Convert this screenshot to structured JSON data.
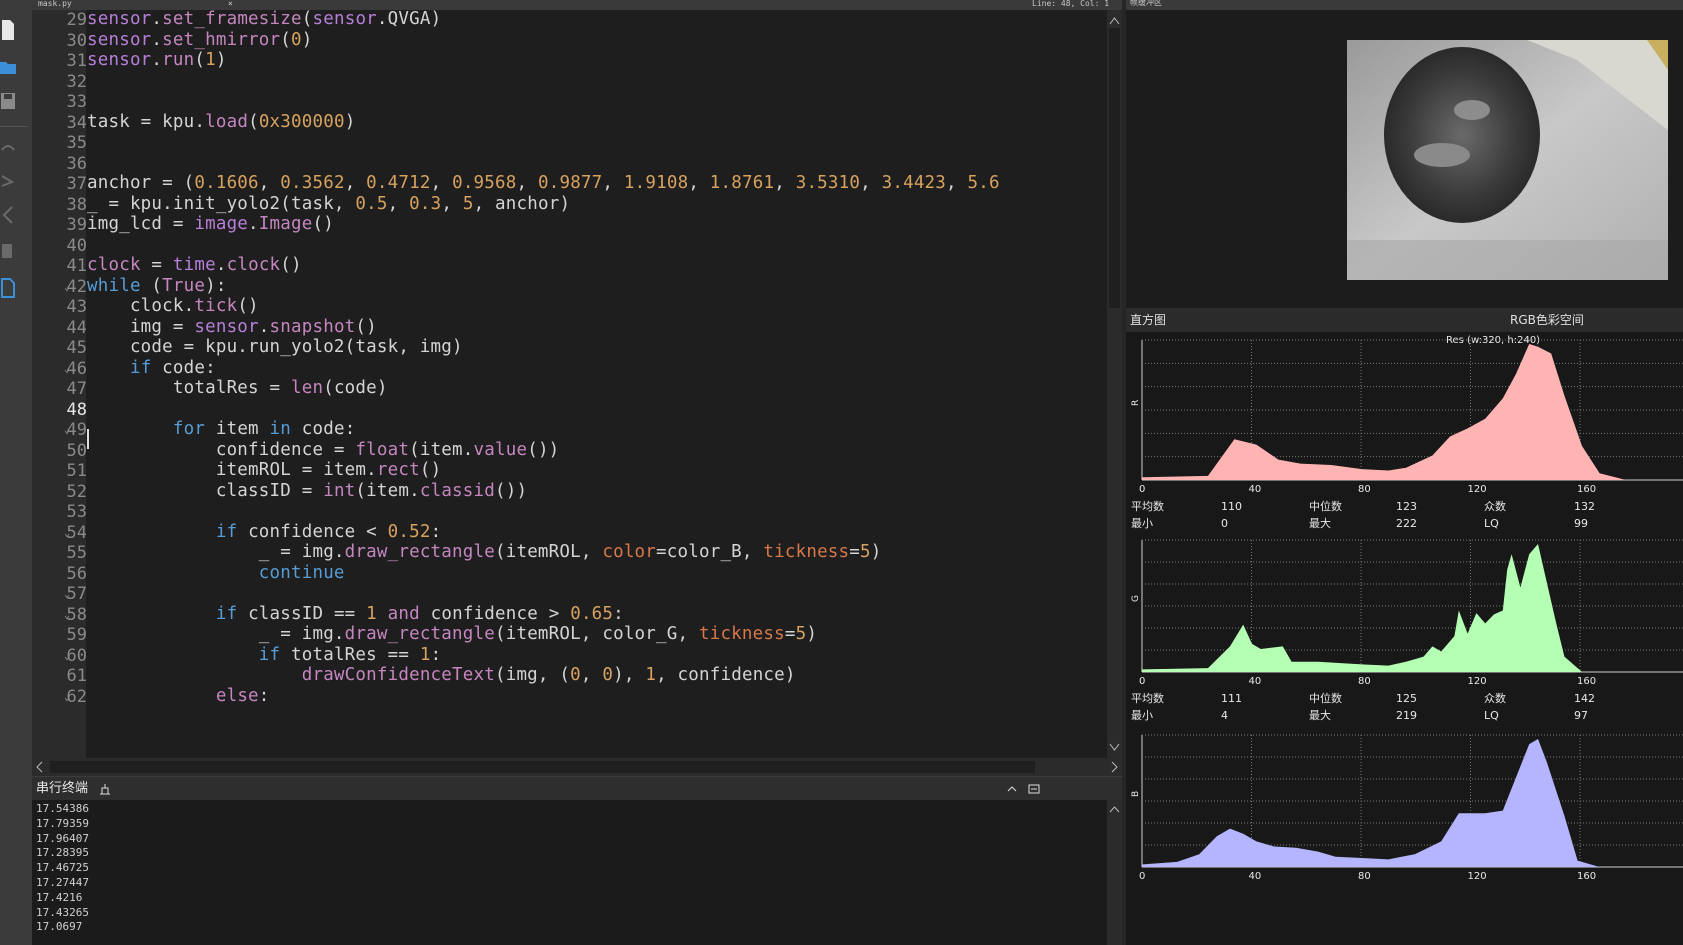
{
  "editor": {
    "tab_name": "mask.py",
    "tab_close": "×",
    "line_col": "Line: 48, Col: 1",
    "current_line": 48,
    "line_numbers": [
      "29",
      "30",
      "31",
      "32",
      "33",
      "34",
      "35",
      "36",
      "37",
      "38",
      "39",
      "40",
      "41",
      "42",
      "43",
      "44",
      "45",
      "46",
      "47",
      "48",
      "49",
      "50",
      "51",
      "52",
      "53",
      "54",
      "55",
      "56",
      "57",
      "58",
      "59",
      "60",
      "61",
      "62"
    ],
    "fold_markers": [
      "42",
      "46",
      "49",
      "54",
      "57",
      "58",
      "60",
      "62"
    ],
    "lines": [
      "sensor.set_framesize(sensor.QVGA)",
      "sensor.set_hmirror(0)",
      "sensor.run(1)",
      "",
      "",
      "task = kpu.load(0x300000)",
      "",
      "",
      "anchor = (0.1606, 0.3562, 0.4712, 0.9568, 0.9877, 1.9108, 1.8761, 3.5310, 3.4423, 5.6",
      "_ = kpu.init_yolo2(task, 0.5, 0.3, 5, anchor)",
      "img_lcd = image.Image()",
      "",
      "clock = time.clock()",
      "while (True):",
      "    clock.tick()",
      "    img = sensor.snapshot()",
      "    code = kpu.run_yolo2(task, img)",
      "    if code:",
      "        totalRes = len(code)",
      "",
      "        for item in code:",
      "            confidence = float(item.value())",
      "            itemROL = item.rect()",
      "            classID = int(item.classid())",
      "",
      "            if confidence < 0.52:",
      "                _ = img.draw_rectangle(itemROL, color=color_B, tickness=5)",
      "                continue",
      "",
      "            if classID == 1 and confidence > 0.65:",
      "                _ = img.draw_rectangle(itemROL, color_G, tickness=5)",
      "                if totalRes == 1:",
      "                    drawConfidenceText(img, (0, 0), 1, confidence)",
      "            else:"
    ]
  },
  "terminal": {
    "title": "串行终端",
    "lines": [
      "17.54386",
      "17.79359",
      "17.96407",
      "17.28395",
      "17.46725",
      "17.27447",
      "17.4216",
      "17.43265",
      "17.0697"
    ]
  },
  "framebuffer": {
    "title": "帧缓冲区"
  },
  "histogram": {
    "tab_hist": "直方图",
    "colorspace": "RGB色彩空间",
    "resolution": "Res (w:320, h:240)",
    "x_ticks": [
      "0",
      "40",
      "80",
      "120",
      "160"
    ],
    "channels": [
      {
        "name": "R",
        "color": "#ffb4b4",
        "stats": {
          "mean_label": "平均数",
          "mean": "110",
          "median_label": "中位数",
          "median": "123",
          "mode_label": "众数",
          "mode": "132",
          "min_label": "最小",
          "min": "0",
          "max_label": "最大",
          "max": "222",
          "lq_label": "LQ",
          "lq": "99"
        }
      },
      {
        "name": "G",
        "color": "#b4ffb4",
        "stats": {
          "mean_label": "平均数",
          "mean": "111",
          "median_label": "中位数",
          "median": "125",
          "mode_label": "众数",
          "mode": "142",
          "min_label": "最小",
          "min": "4",
          "max_label": "最大",
          "max": "219",
          "lq_label": "LQ",
          "lq": "97"
        }
      },
      {
        "name": "B",
        "color": "#b4b4ff",
        "stats": {}
      }
    ]
  },
  "colors": {
    "editor_bg": "#1e1e1e",
    "keyword": "#c586c0",
    "number": "#d7a15f",
    "kwarg": "#d7774a",
    "blue_kw": "#569cd6"
  }
}
